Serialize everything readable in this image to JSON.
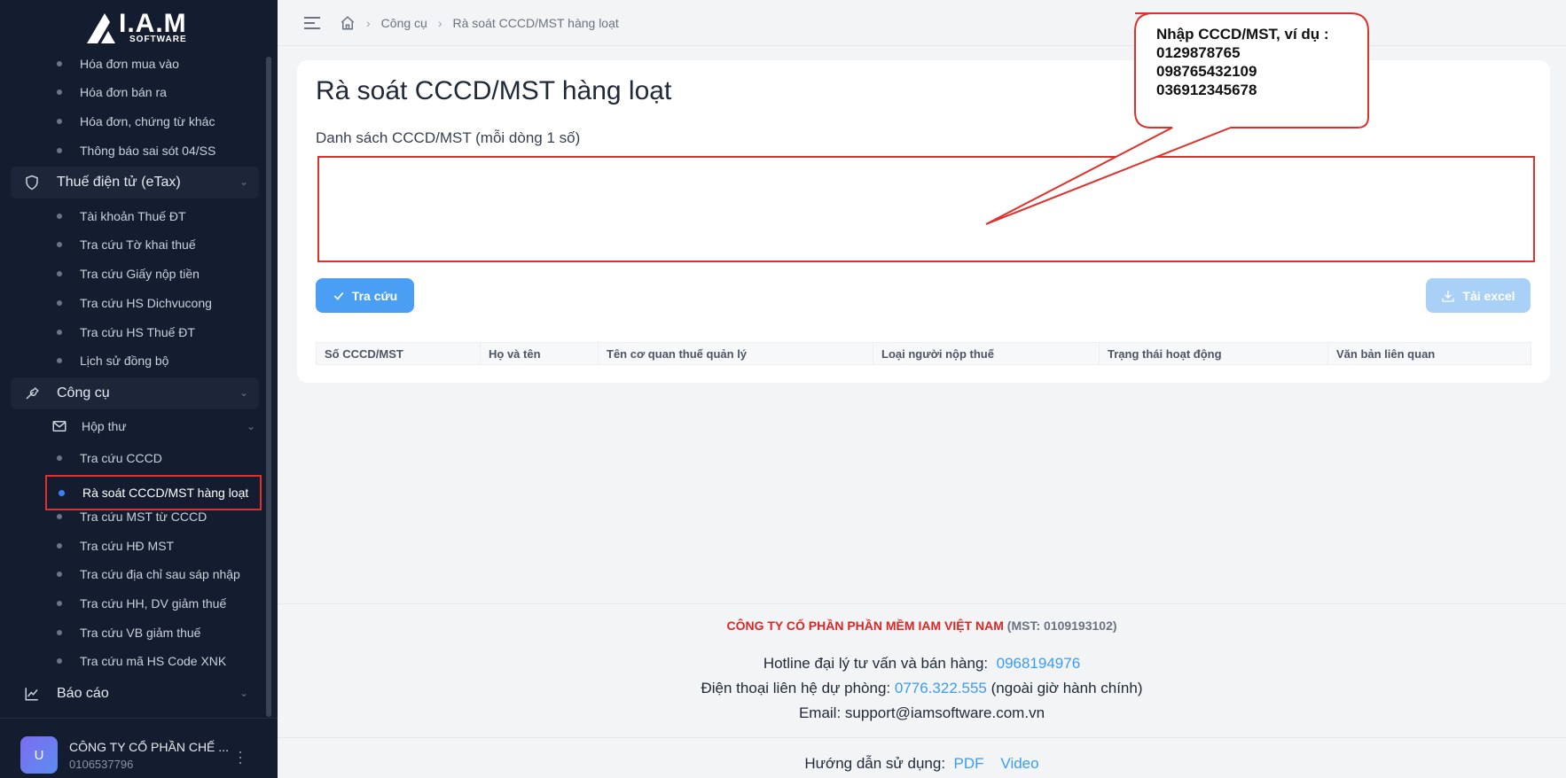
{
  "logo": {
    "main": "I.A.M",
    "sub": "SOFTWARE"
  },
  "sidebar": {
    "top_items": [
      {
        "label": "Hóa đơn mua vào"
      },
      {
        "label": "Hóa đơn bán ra"
      },
      {
        "label": "Hóa đơn, chứng từ khác"
      },
      {
        "label": "Thông báo sai sót 04/SS"
      }
    ],
    "group_etax": {
      "label": "Thuế điện tử (eTax)",
      "items": [
        {
          "label": "Tài khoản Thuế ĐT"
        },
        {
          "label": "Tra cứu Tờ khai thuế"
        },
        {
          "label": "Tra cứu Giấy nộp tiền"
        },
        {
          "label": "Tra cứu HS Dichvucong"
        },
        {
          "label": "Tra cứu HS Thuế ĐT"
        },
        {
          "label": "Lịch sử đồng bộ"
        }
      ]
    },
    "group_tools": {
      "label": "Công cụ",
      "mailbox": "Hộp thư",
      "items_before": [
        {
          "label": "Tra cứu CCCD"
        }
      ],
      "active": "Rà soát CCCD/MST hàng loạt",
      "items_after": [
        {
          "label": "Tra cứu MST từ CCCD"
        },
        {
          "label": "Tra cứu HĐ MST"
        },
        {
          "label": "Tra cứu địa chỉ sau sáp nhập"
        },
        {
          "label": "Tra cứu HH, DV giảm thuế"
        },
        {
          "label": "Tra cứu VB giảm thuế"
        },
        {
          "label": "Tra cứu mã HS Code XNK"
        }
      ]
    },
    "group_reports": {
      "label": "Báo cáo"
    },
    "user": {
      "avatar": "U",
      "name": "CÔNG TY CỔ PHẦN CHẾ ...",
      "mst": "0106537796"
    }
  },
  "breadcrumb": {
    "items": [
      "Công cụ",
      "Rà soát CCCD/MST hàng loạt"
    ]
  },
  "main": {
    "title": "Rà soát CCCD/MST hàng loạt",
    "list_label": "Danh sách CCCD/MST (mỗi dòng 1 số)",
    "textarea_value": "",
    "search_button": "Tra cứu",
    "excel_button": "Tải excel",
    "table_headers": [
      "Số CCCD/MST",
      "Họ và tên",
      "Tên cơ quan thuế quản lý",
      "Loại người nộp thuế",
      "Trạng thái hoạt động",
      "Văn bản liên quan"
    ]
  },
  "callout": {
    "lines": [
      "Nhập CCCD/MST, ví dụ :",
      "0129878765",
      "098765432109",
      "036912345678"
    ]
  },
  "footer": {
    "company": "CÔNG TY CỔ PHẦN PHẦN MỀM IAM VIỆT NAM",
    "company_mst": "(MST: 0109193102)",
    "hotline_label": "Hotline đại lý tư vấn và bán hàng:",
    "hotline": "0968194976",
    "backup_label": "Điện thoại liên hệ dự phòng:",
    "backup_phone": "0776.322.555",
    "backup_note": "(ngoài giờ hành chính)",
    "email": "Email: support@iamsoftware.com.vn",
    "guide_label": "Hướng dẫn sử dụng:",
    "guide_pdf": "PDF",
    "guide_video": "Video"
  },
  "colors": {
    "sidebar_bg": "#141d2f",
    "accent": "#4a9ff5",
    "highlight_red": "#e0302b",
    "active_dot": "#3b82f6"
  }
}
